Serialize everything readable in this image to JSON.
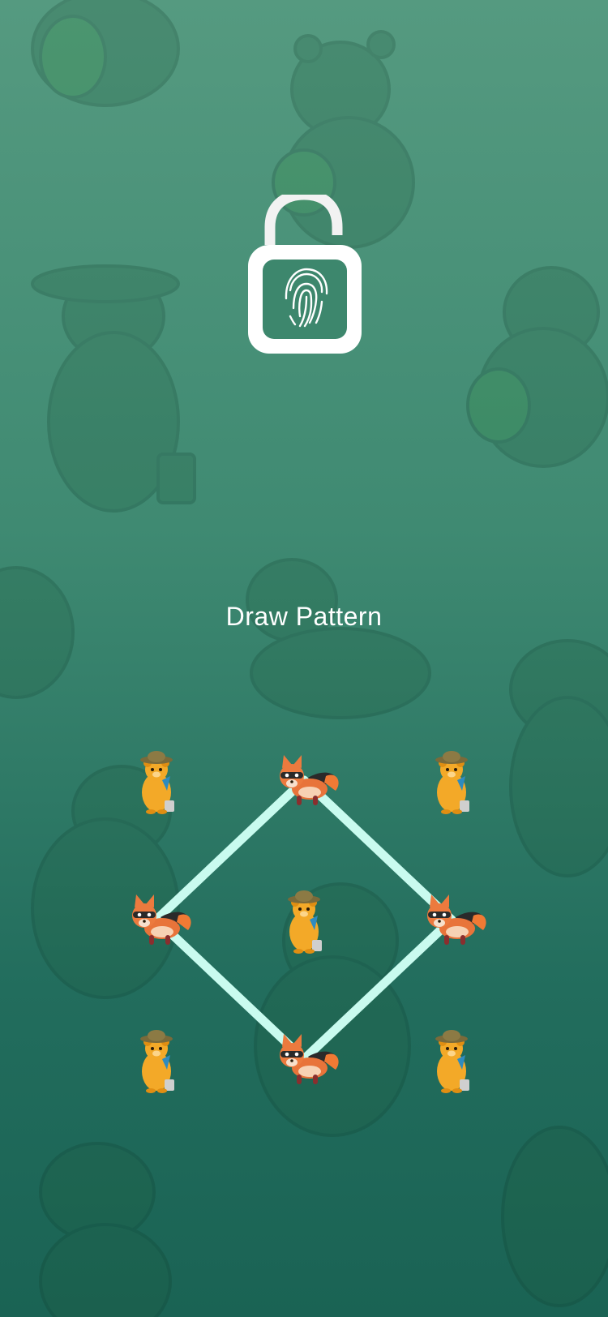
{
  "screen": {
    "title": "Draw Pattern"
  },
  "lock_icon": {
    "icon": "fingerprint-unlock-icon"
  },
  "pattern": {
    "grid_size": 3,
    "selected_sequence": [
      2,
      4,
      8,
      6
    ],
    "dots": [
      {
        "index": 1,
        "character": "bear-icon",
        "selected": false
      },
      {
        "index": 2,
        "character": "fox-icon",
        "selected": true
      },
      {
        "index": 3,
        "character": "bear-icon",
        "selected": false
      },
      {
        "index": 4,
        "character": "fox-icon",
        "selected": true
      },
      {
        "index": 5,
        "character": "bear-icon",
        "selected": false
      },
      {
        "index": 6,
        "character": "fox-icon",
        "selected": true
      },
      {
        "index": 7,
        "character": "bear-icon",
        "selected": false
      },
      {
        "index": 8,
        "character": "fox-icon",
        "selected": true
      },
      {
        "index": 9,
        "character": "bear-icon",
        "selected": false
      }
    ]
  },
  "colors": {
    "background_top": "#559a80",
    "background_bottom": "#1a6354",
    "pattern_line": "#c9fbef",
    "text": "#ffffff"
  }
}
